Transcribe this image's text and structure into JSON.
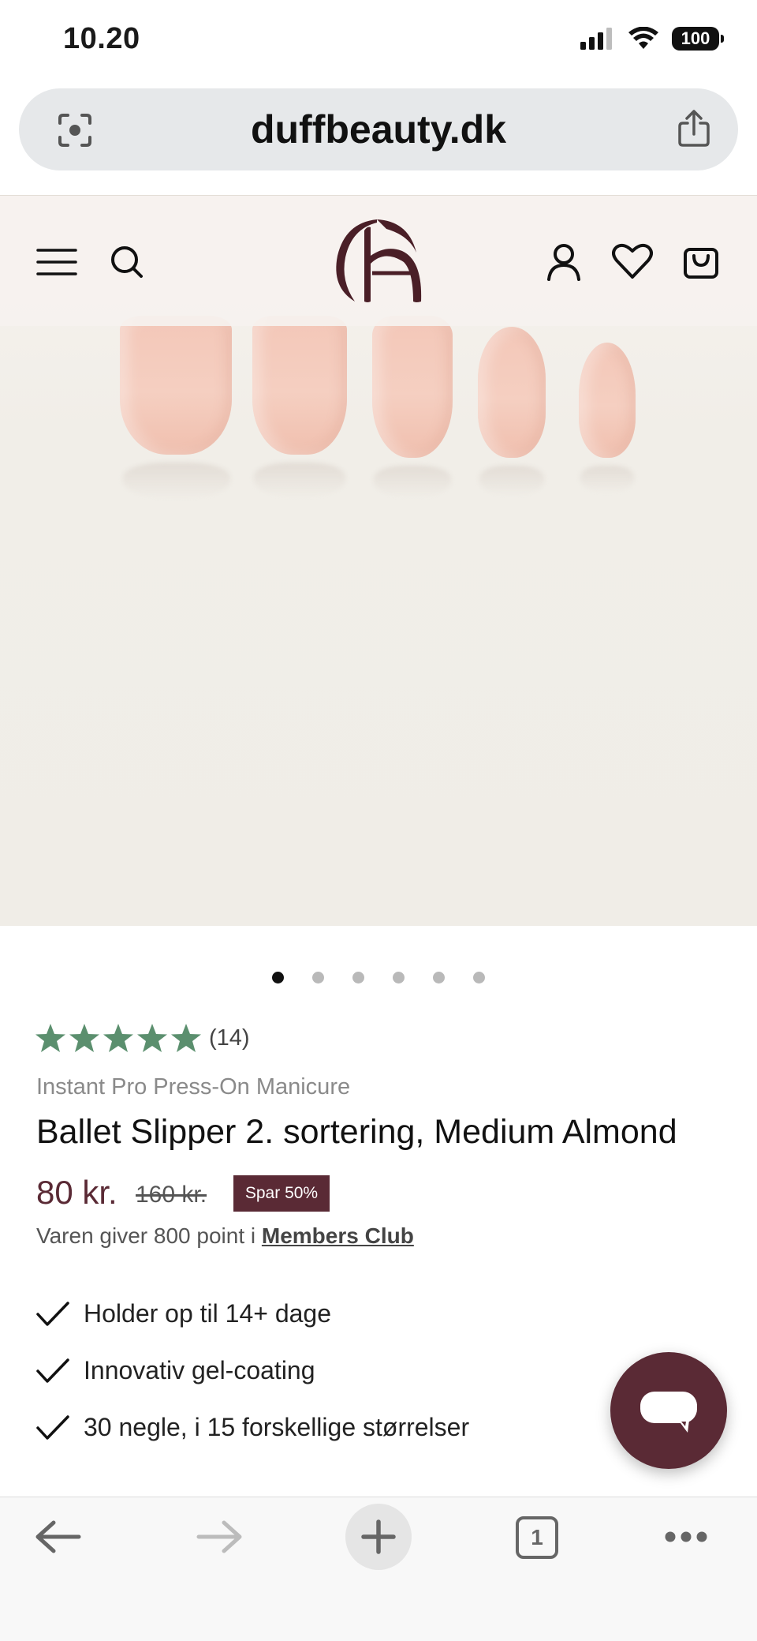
{
  "status_bar": {
    "time": "10.20",
    "battery": "100"
  },
  "browser": {
    "url": "duffbeauty.dk"
  },
  "product": {
    "rating_count": "(14)",
    "rating_stars": 5,
    "subtitle": "Instant Pro Press-On Manicure",
    "title": "Ballet Slipper 2. sortering, Medium Almond",
    "price": "80 kr.",
    "old_price": "160 kr.",
    "save_badge": "Spar 50%",
    "points_text": "Varen giver 800 point i ",
    "points_link": "Members Club",
    "benefits": [
      "Holder op til 14+ dage",
      "Innovativ gel-coating",
      "30 negle, i 15 forskellige størrelser"
    ]
  },
  "gallery": {
    "slide_count": 6,
    "active_slide": 1
  },
  "tabs": {
    "count": "1"
  },
  "colors": {
    "brand": "#5a2a35",
    "star": "#5b8f6e"
  }
}
